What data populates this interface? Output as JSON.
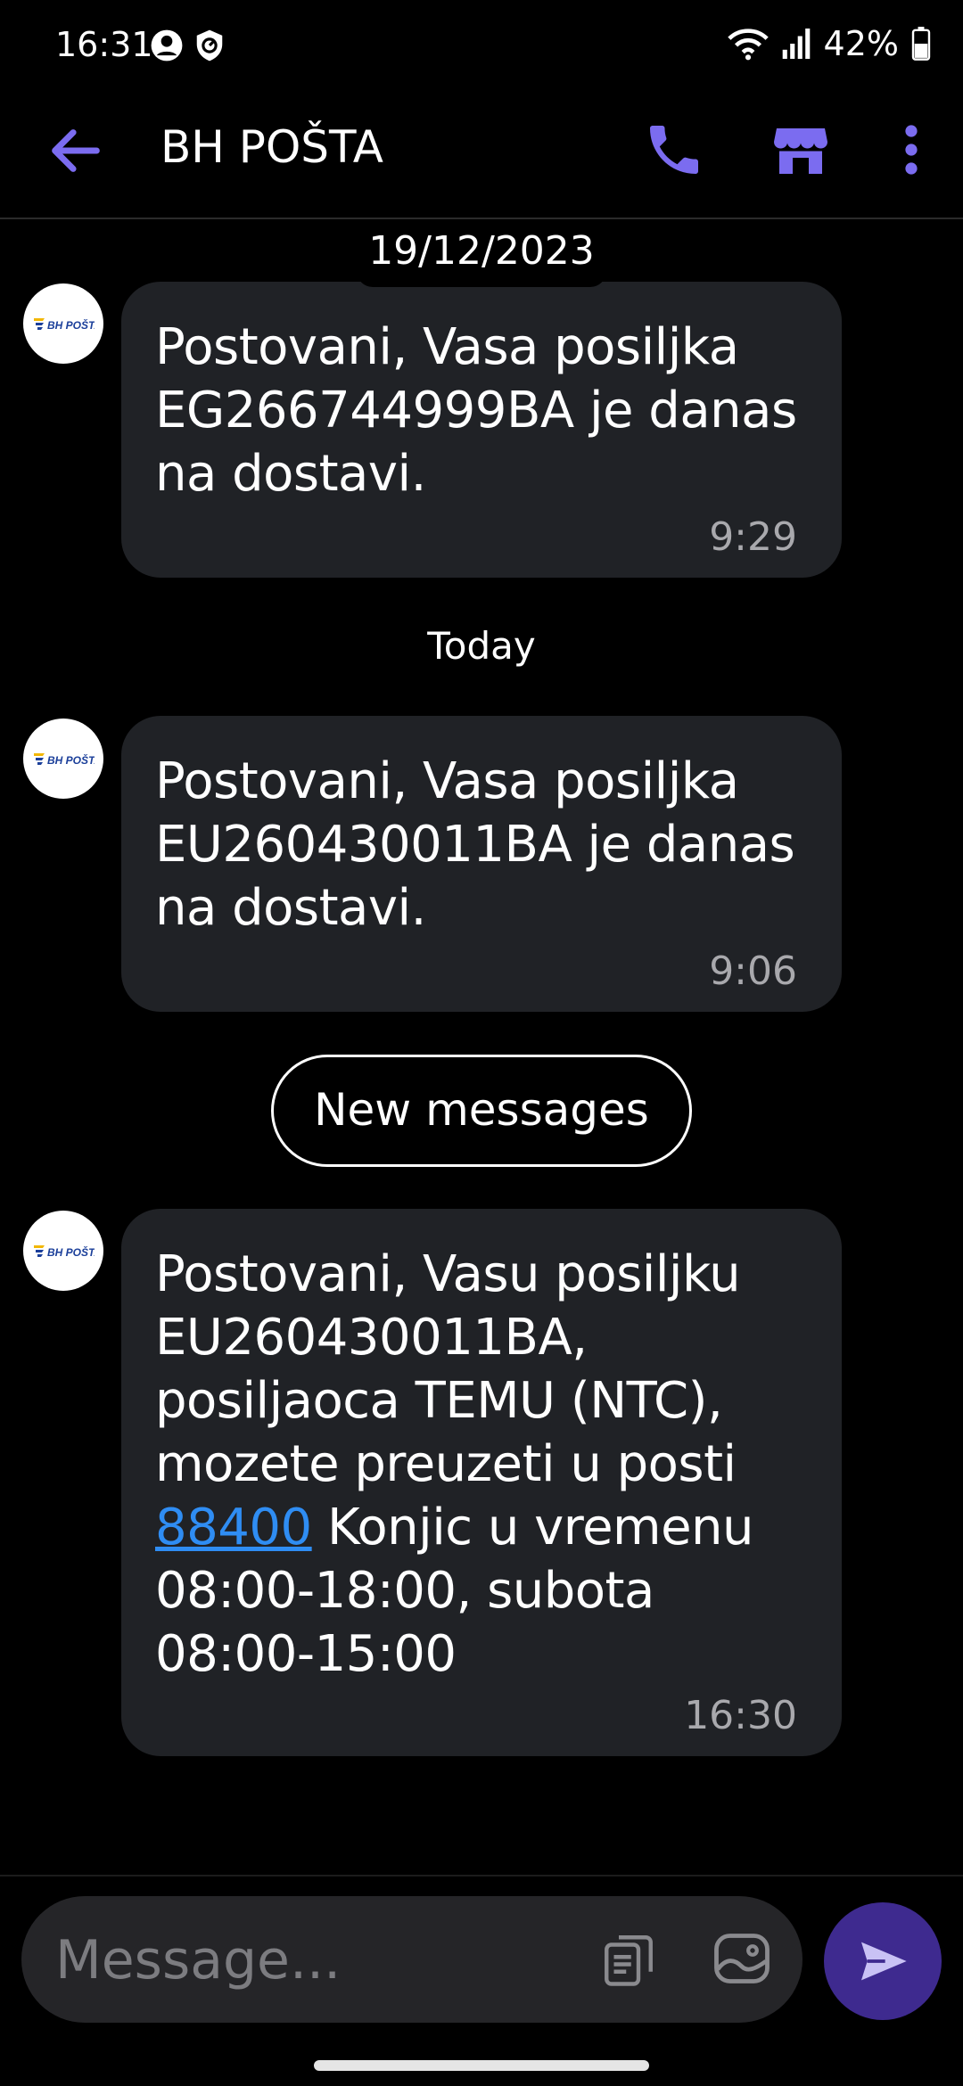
{
  "status_bar": {
    "time": "16:31",
    "battery": "42%",
    "icons": [
      "account-circle-icon",
      "shield-icon",
      "wifi-icon",
      "signal-icon",
      "battery-icon"
    ]
  },
  "app_bar": {
    "title": "BH POŠTA",
    "icons": [
      "back-arrow-icon",
      "phone-icon",
      "store-icon",
      "more-vert-icon"
    ],
    "accent_color": "#7b6cf0"
  },
  "conversation": {
    "date_separator": "19/12/2023",
    "today_separator": "Today",
    "new_messages_label": "New messages",
    "messages": [
      {
        "sender_avatar": "BH POŠTA",
        "text": "Postovani, Vasa posiljka\nEG266744999BA je danas\nna dostavi.",
        "time": "9:29"
      },
      {
        "sender_avatar": "BH POŠTA",
        "text": "Postovani, Vasa posiljka\nEU260430011BA je danas\nna dostavi.",
        "time": "9:06"
      },
      {
        "sender_avatar": "BH POŠTA",
        "text_before_link": "Postovani, Vasu posiljku\nEU260430011BA,\nposiljaoca TEMU (NTC),\nmozete preuzeti u posti\n",
        "link": "88400",
        "text_after_link": " Konjic u vremenu\n08:00-18:00, subota\n08:00-15:00",
        "time": "16:30"
      }
    ]
  },
  "composer": {
    "placeholder": "Message...",
    "icons": [
      "template-icon",
      "image-icon",
      "send-icon"
    ],
    "send_color": "#3e2a8f"
  }
}
